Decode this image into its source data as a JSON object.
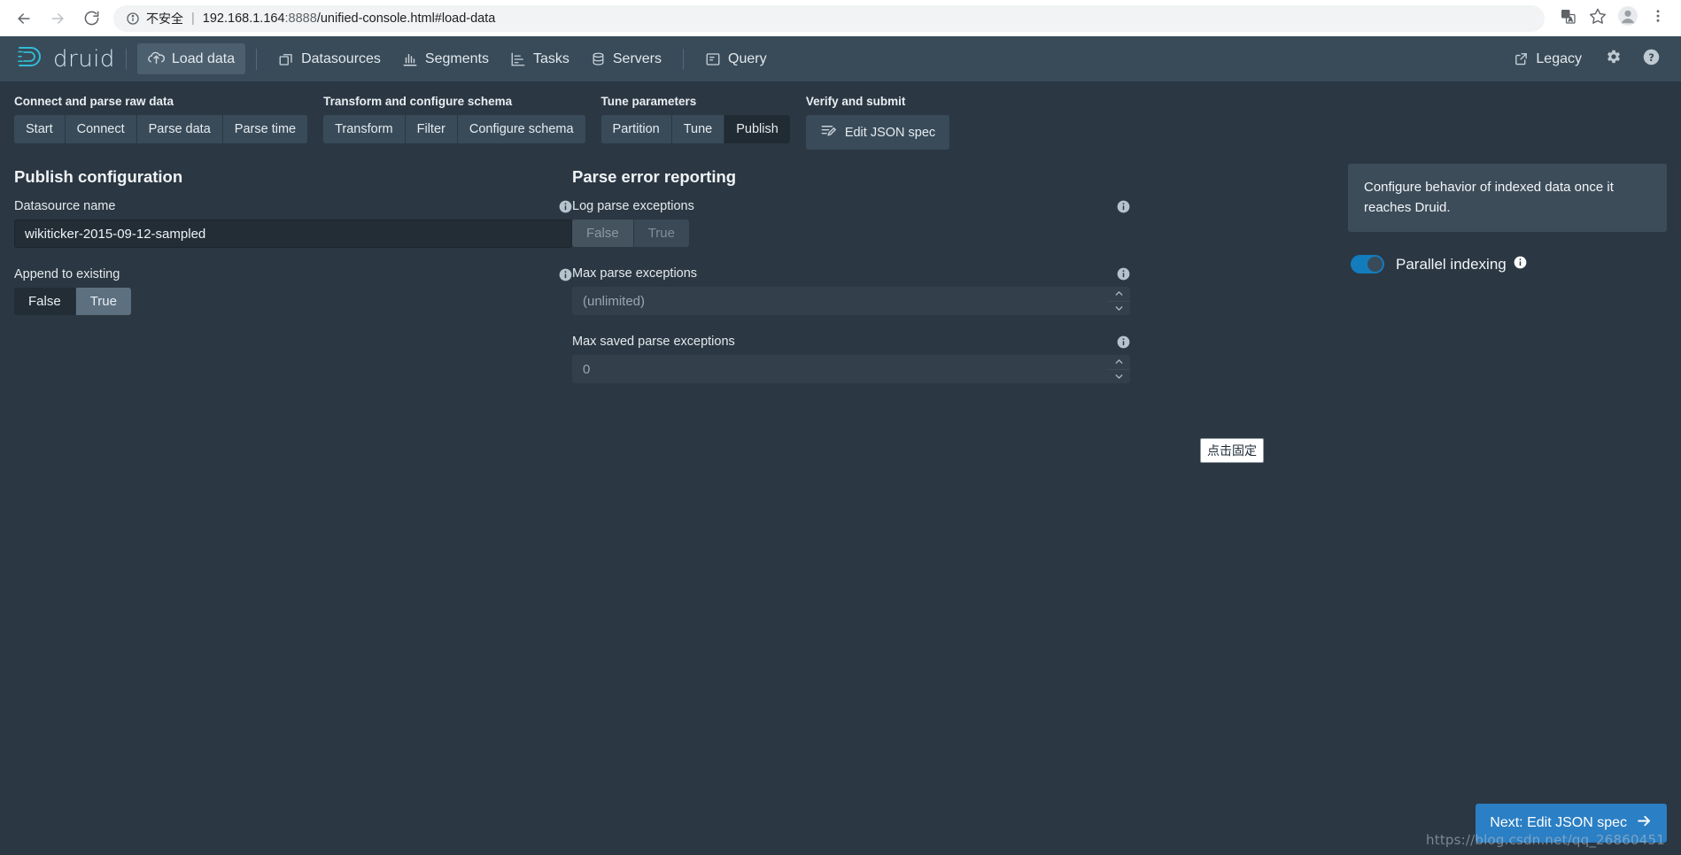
{
  "browser": {
    "back_icon": "back-arrow-icon",
    "forward_icon": "forward-arrow-icon",
    "reload_icon": "reload-icon",
    "security_label": "不安全",
    "url_host": "192.168.1.164",
    "url_port": ":8888",
    "url_path": "/unified-console.html#load-data",
    "translate_icon": "translate-icon",
    "bookmark_icon": "star-icon",
    "profile_icon": "avatar-icon",
    "menu_icon": "three-dot-menu-icon"
  },
  "navbar": {
    "brand": "druid",
    "items": [
      {
        "label": "Load data",
        "icon": "upload-cloud-icon",
        "active": true
      },
      {
        "label": "Datasources",
        "icon": "stack-icon",
        "active": false
      },
      {
        "label": "Segments",
        "icon": "bar-chart-icon",
        "active": false
      },
      {
        "label": "Tasks",
        "icon": "gantt-icon",
        "active": false
      },
      {
        "label": "Servers",
        "icon": "database-icon",
        "active": false
      },
      {
        "label": "Query",
        "icon": "console-icon",
        "active": false
      }
    ],
    "legacy_label": "Legacy",
    "legacy_icon": "external-link-icon",
    "settings_icon": "gear-icon",
    "help_icon": "help-circle-icon"
  },
  "steps": [
    {
      "title": "Connect and parse raw data",
      "buttons": [
        {
          "label": "Start",
          "active": false
        },
        {
          "label": "Connect",
          "active": false
        },
        {
          "label": "Parse data",
          "active": false
        },
        {
          "label": "Parse time",
          "active": false
        }
      ]
    },
    {
      "title": "Transform and configure schema",
      "buttons": [
        {
          "label": "Transform",
          "active": false
        },
        {
          "label": "Filter",
          "active": false
        },
        {
          "label": "Configure schema",
          "active": false
        }
      ]
    },
    {
      "title": "Tune parameters",
      "buttons": [
        {
          "label": "Partition",
          "active": false
        },
        {
          "label": "Tune",
          "active": false
        },
        {
          "label": "Publish",
          "active": true
        }
      ]
    },
    {
      "title": "Verify and submit",
      "json_spec_label": "Edit JSON spec",
      "json_spec_icon": "json-edit-icon"
    }
  ],
  "publish": {
    "heading": "Publish configuration",
    "datasource_name": {
      "label": "Datasource name",
      "value": "wikiticker-2015-09-12-sampled",
      "info_icon": "info-icon"
    },
    "append_to_existing": {
      "label": "Append to existing",
      "info_icon": "info-icon",
      "options": [
        {
          "label": "False",
          "selected": false
        },
        {
          "label": "True",
          "selected": true
        }
      ]
    }
  },
  "parse_error": {
    "heading": "Parse error reporting",
    "log_parse_exceptions": {
      "label": "Log parse exceptions",
      "info_icon": "info-icon",
      "disabled": true,
      "options": [
        {
          "label": "False",
          "selected": true
        },
        {
          "label": "True",
          "selected": false
        }
      ]
    },
    "max_parse_exceptions": {
      "label": "Max parse exceptions",
      "placeholder": "(unlimited)",
      "value": "",
      "info_icon": "info-icon",
      "spinner_up_icon": "chevron-up-icon",
      "spinner_down_icon": "chevron-down-icon"
    },
    "max_saved_parse_exceptions": {
      "label": "Max saved parse exceptions",
      "placeholder": "0",
      "value": "",
      "info_icon": "info-icon",
      "spinner_up_icon": "chevron-up-icon",
      "spinner_down_icon": "chevron-down-icon"
    }
  },
  "sidebar": {
    "info_text": "Configure behavior of indexed data once it reaches Druid.",
    "parallel_indexing": {
      "label": "Parallel indexing",
      "enabled": true,
      "info_icon": "info-icon"
    }
  },
  "tooltip": {
    "text": "点击固定"
  },
  "footer": {
    "next_label": "Next: Edit JSON spec",
    "next_icon": "arrow-right-icon",
    "watermark": "https://blog.csdn.net/qq_26860451"
  },
  "colors": {
    "accent_blue": "#137cbd",
    "next_button": "#2b7fc4",
    "navbar_bg": "#394b59",
    "page_bg": "#2b3742",
    "input_bg": "#232d36"
  }
}
